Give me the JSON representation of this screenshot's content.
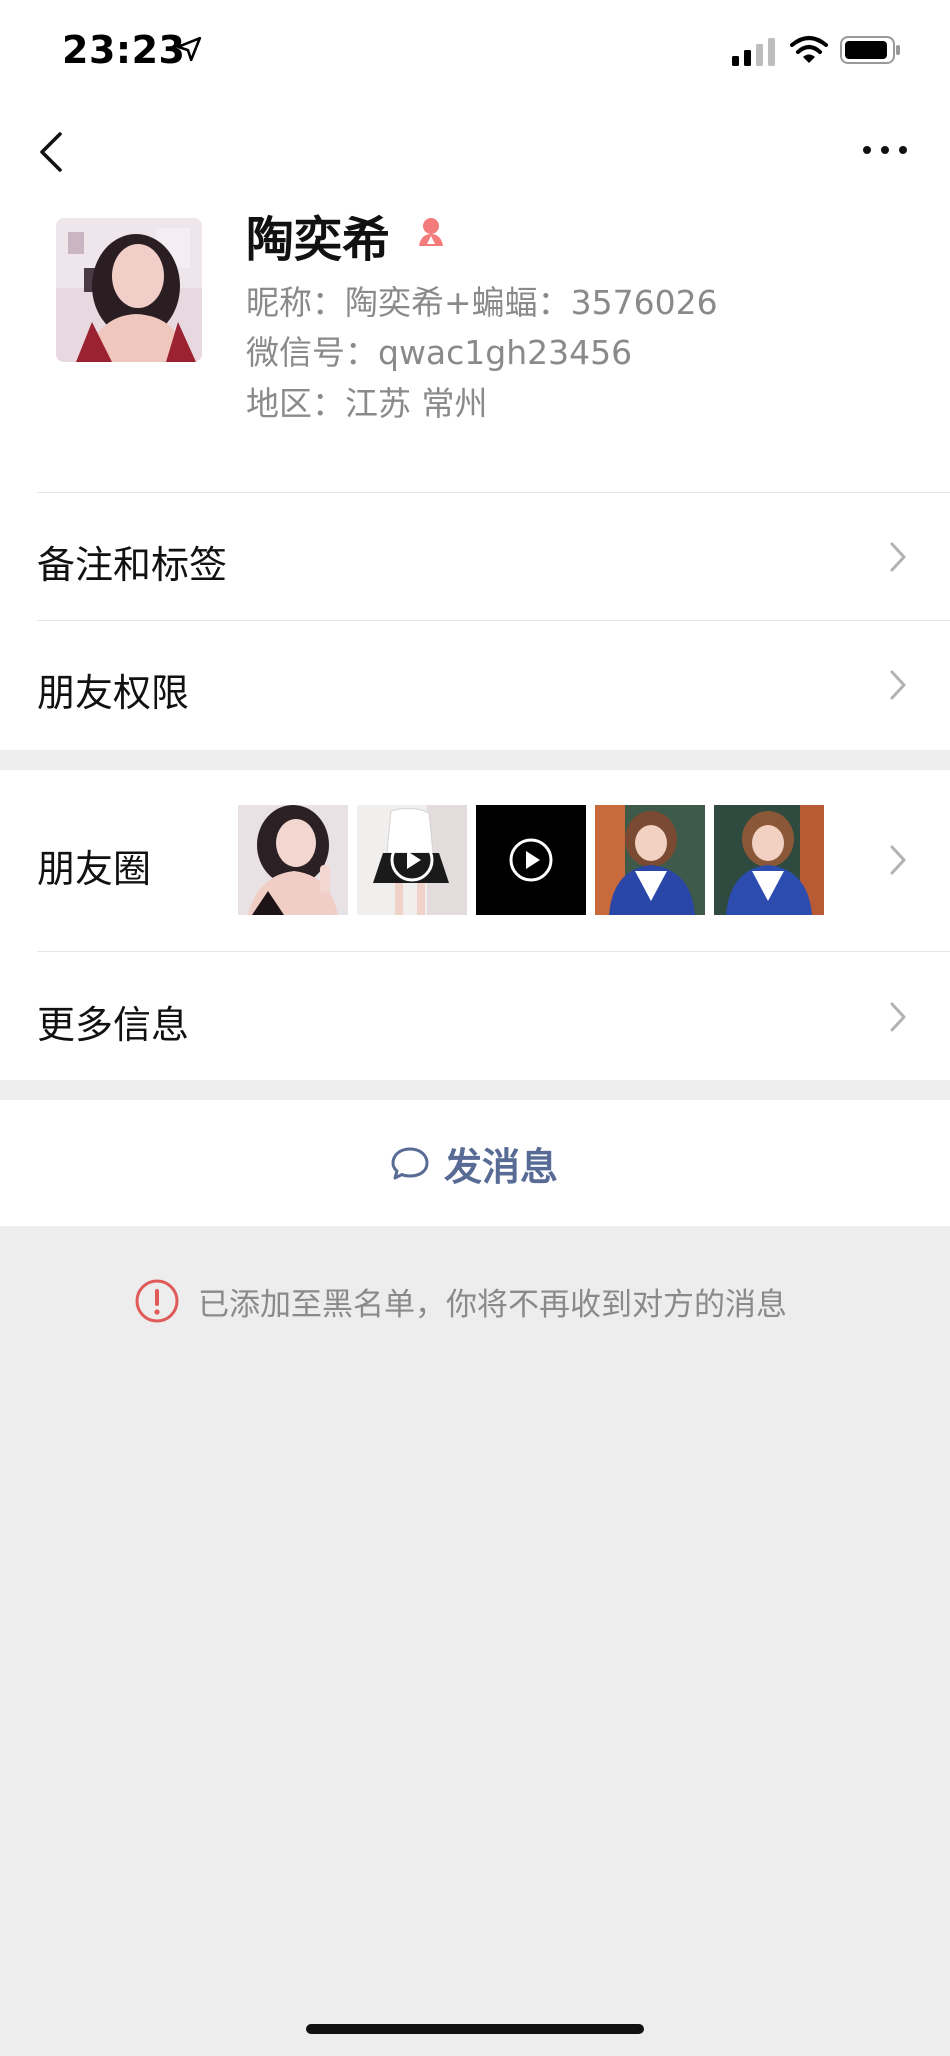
{
  "status_bar": {
    "time": "23:23"
  },
  "profile": {
    "name": "陶奕希",
    "nickname_line": "昵称：陶奕希+蝙蝠：3576026",
    "wechat_id_line": "微信号：qwac1gh23456",
    "region_line": "地区：江苏 常州"
  },
  "menu": {
    "remark_tags": "备注和标签",
    "friend_permissions": "朋友权限",
    "moments": "朋友圈",
    "more_info": "更多信息"
  },
  "actions": {
    "send_message": "发消息"
  },
  "notice": {
    "blacklist_text": "已添加至黑名单，你将不再收到对方的消息"
  },
  "colors": {
    "link_blue": "#576b95",
    "warning_red": "#e05a5a",
    "gender_pink": "#f37b7b"
  }
}
